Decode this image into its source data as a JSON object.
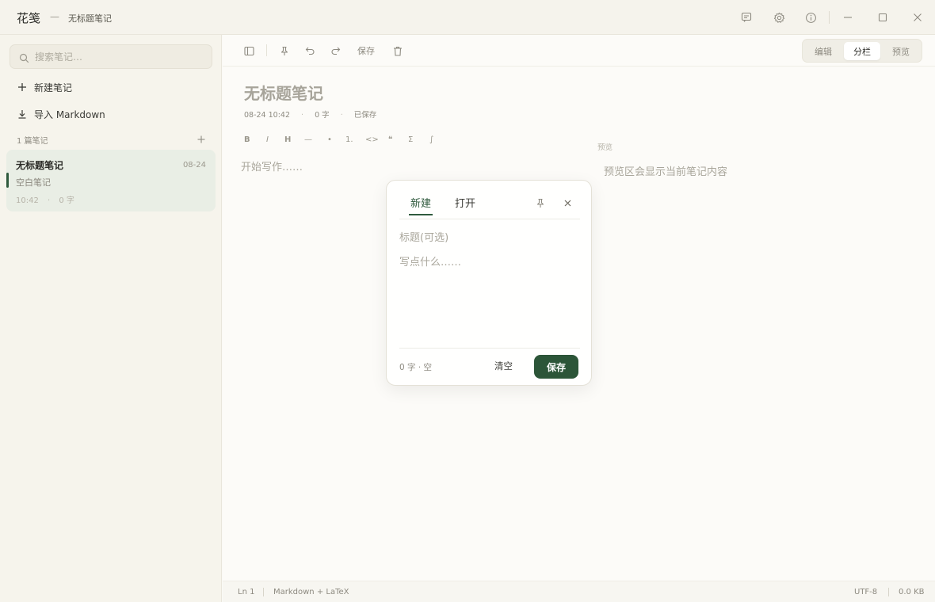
{
  "titlebar": {
    "app_name": "花笺",
    "separator": "—",
    "doc_name": "无标题笔记",
    "icons": [
      "feedback-icon",
      "gear-icon",
      "info-icon",
      "minimize-icon",
      "maximize-icon",
      "close-icon"
    ]
  },
  "sidebar": {
    "search_placeholder": "搜索笔记…",
    "new_note": "新建笔记",
    "import_markdown": "导入 Markdown",
    "notes_count": "1 篇笔记",
    "add": "+",
    "notes": [
      {
        "title": "无标题笔记",
        "date": "08-24",
        "excerpt": "空白笔记",
        "time": "10:42",
        "sep": "·",
        "words": "0 字"
      }
    ]
  },
  "toolbar": {
    "save": "保存",
    "views": [
      "编辑",
      "分栏",
      "预览"
    ],
    "active_view": "分栏"
  },
  "document": {
    "title": "无标题笔记",
    "datetime": "08-24 10:42",
    "dot": "·",
    "words": "0 字",
    "saved": "已保存",
    "editor_placeholder": "开始写作……",
    "preview_label": "预览",
    "preview_placeholder": "预览区会显示当前笔记内容"
  },
  "format_toolbar": [
    "B",
    "I",
    "H",
    "—",
    "•",
    "1.",
    "<>",
    "❝",
    "Σ",
    "∫"
  ],
  "statusbar": {
    "line": "Ln 1",
    "mode": "Markdown + LaTeX",
    "encoding": "UTF-8",
    "size": "0.0 KB"
  },
  "dialog": {
    "tab_new": "新建",
    "tab_open": "打开",
    "title_placeholder": "标题(可选)",
    "body_placeholder": "写点什么……",
    "count": "0 字 · 空",
    "clear": "清空",
    "save": "保存"
  },
  "colors": {
    "accent": "#2c5538",
    "sidebar_bg": "#f6f4ec",
    "selected_note_bg": "#e9eee5"
  }
}
